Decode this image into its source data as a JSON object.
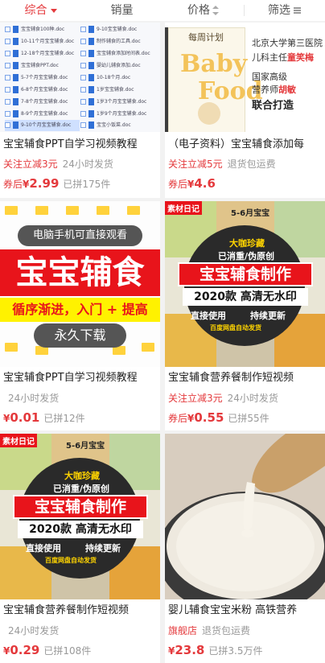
{
  "sort_bar": {
    "items": [
      {
        "label": "综合",
        "active": true
      },
      {
        "label": "销量",
        "active": false
      },
      {
        "label": "价格",
        "active": false
      },
      {
        "label": "筛选",
        "active": false
      }
    ]
  },
  "products": [
    {
      "title": "宝宝辅食PPT自学习视频教程",
      "meta_tag": "关注立减3元",
      "meta": "24小时发货",
      "price_prefix": "券后",
      "price": "2.99",
      "sold": "已拼175件",
      "thumb": {
        "files": [
          "宝宝辅食100种.doc",
          "10-11个月宝宝辅食.doc",
          "12-18个月宝宝辅食.doc",
          "宝宝辅食PPT.doc",
          "5-7个月宝宝辅食.doc",
          "6-8个月宝宝辅食.doc",
          "7-8个月宝宝辅食.doc",
          "8-9个月宝宝辅食.doc",
          "9-10个月宝宝辅食.doc"
        ],
        "files2": [
          "9-10宝宝辅食.doc",
          "制作辅食的工具.doc",
          "宝宝辅食添加时间表.doc",
          "婴幼儿辅食添加.doc",
          "10-18个月.doc",
          "1岁宝宝辅食.doc",
          "1岁3个月宝宝辅食.doc",
          "1岁9个月宝宝辅食.doc",
          "宝宝小饭菜.doc"
        ]
      }
    },
    {
      "title": "（电子资料）宝宝辅食添加每",
      "meta_tag": "关注立减5元",
      "meta": "退货包运费",
      "price_prefix": "券后",
      "price": "4.6",
      "sold": "",
      "thumb": {
        "plan": "每周计划",
        "hospital": "北京大学第三医院",
        "dept": "儿科主任",
        "doctor": "童笑梅",
        "nation": "国家高级",
        "nutritionist": "营养师",
        "person": "胡敏",
        "joint": "联合打造",
        "baby": "Baby",
        "food": "Food"
      }
    },
    {
      "title": "宝宝辅食PPT自学习视频教程",
      "meta_tag": "",
      "meta": "24小时发货",
      "price_prefix": "",
      "price": "0.01",
      "sold": "已拼12件",
      "thumb": {
        "pill_top": "电脑手机可直接观看",
        "headline": "宝宝辅食",
        "strip": "循序渐进，入门 + 提高",
        "pill_bottom": "永久下载"
      }
    },
    {
      "title": "宝宝辅食营养餐制作短视频",
      "meta_tag": "关注立减3元",
      "meta": "24小时发货",
      "price_prefix": "券后",
      "price": "0.55",
      "sold": "已拼55件",
      "thumb": {
        "corner": "素材日记",
        "age": "5-6月宝宝",
        "collect": "大咖珍藏",
        "original": "已消重/伪原创",
        "headline": "宝宝辅食制作",
        "year": "2020款",
        "hd": "高清无水印",
        "direct": "直接使用",
        "update": "持续更新",
        "cloud": "百度网盘自动发货"
      }
    },
    {
      "title": "宝宝辅食营养餐制作短视频",
      "meta_tag": "",
      "meta": "24小时发货",
      "price_prefix": "",
      "price": "0.29",
      "sold": "已拼108件",
      "thumb": {
        "corner": "素材日记",
        "age": "5-6月宝宝",
        "collect": "大咖珍藏",
        "original": "已消重/伪原创",
        "headline": "宝宝辅食制作",
        "year": "2020款",
        "hd": "高清无水印",
        "direct": "直接使用",
        "update": "持续更新",
        "cloud": "百度网盘自动发货"
      }
    },
    {
      "title": "婴儿辅食宝宝米粉 高铁营养",
      "meta_tag": "旗舰店",
      "meta": "退货包运费",
      "price_prefix": "",
      "price": "23.8",
      "sold": "已拼3.5万件",
      "thumb": {}
    }
  ],
  "colors": {
    "accent": "#e4393c",
    "muted": "#999999"
  }
}
